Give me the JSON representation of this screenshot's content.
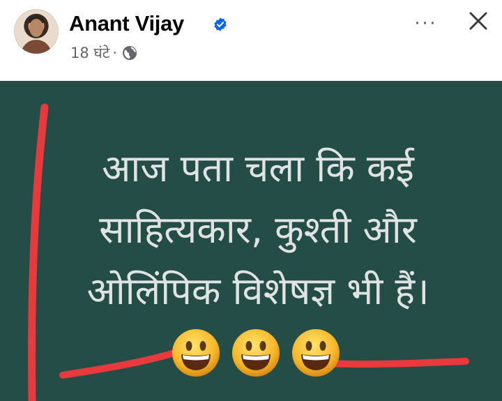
{
  "post": {
    "author_name": "Anant Vijay",
    "timestamp": "18 घंटे",
    "separator": "·",
    "privacy_icon": "globe-icon",
    "verified_icon": "verified-badge-icon",
    "more_label": "···",
    "close_icon": "close-icon"
  },
  "image": {
    "lines": [
      "आज पता चला कि कई",
      "साहित्यकार, कुश्ती और",
      "ओलिंपिक विशेषज्ञ भी हैं।"
    ],
    "emojis": [
      "grinning-face-emoji",
      "grinning-face-emoji",
      "grinning-face-emoji"
    ]
  },
  "colors": {
    "board": "#254d47",
    "marker": "#e8393c",
    "text": "#dfe3e3",
    "verified": "#0866ff",
    "meta": "#65676b"
  }
}
